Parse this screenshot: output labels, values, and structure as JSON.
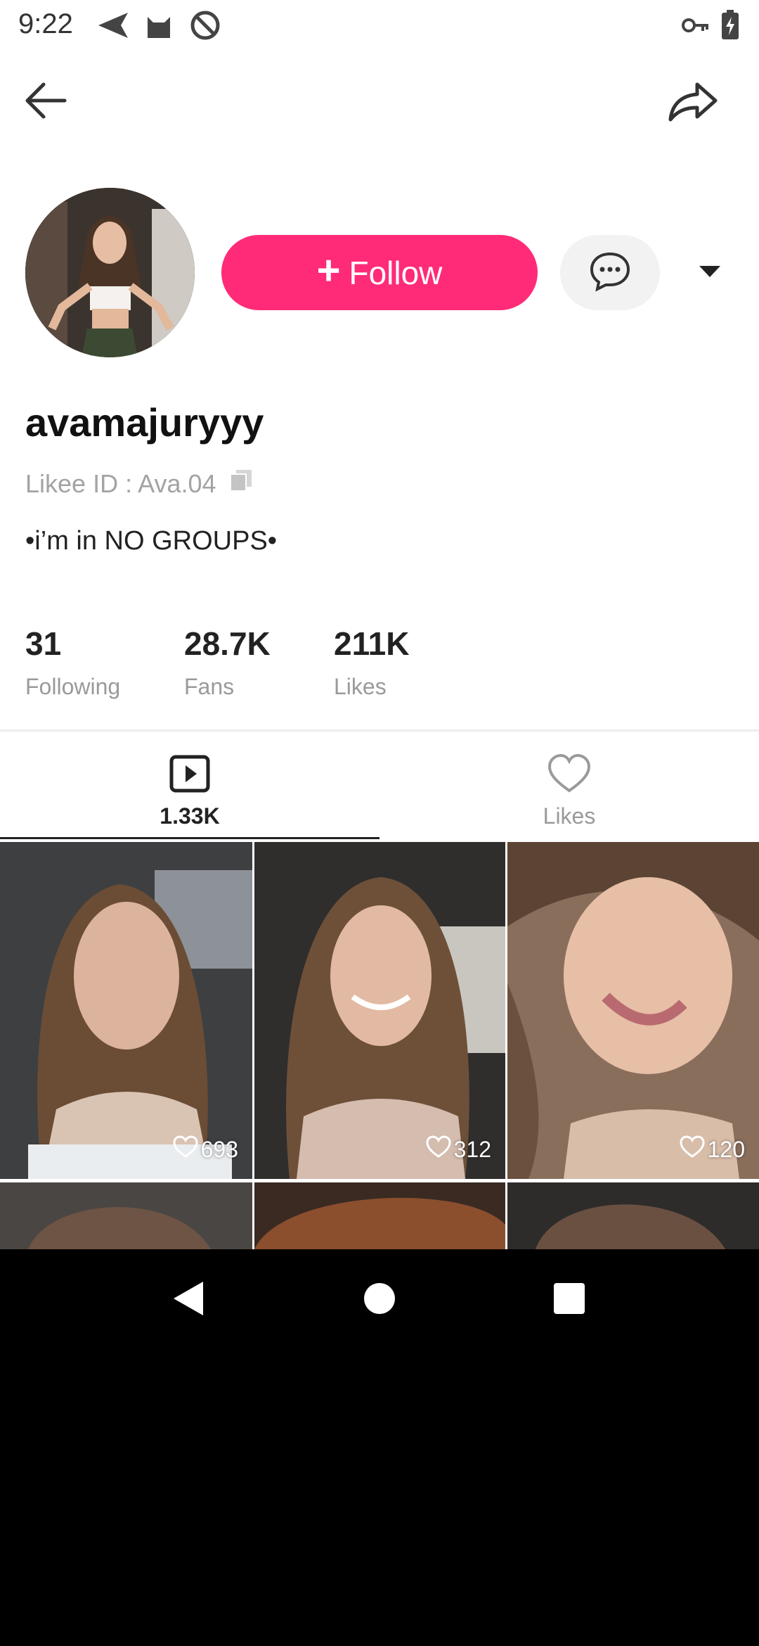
{
  "status_bar": {
    "time": "9:22",
    "icons": [
      "send-icon",
      "cat-icon",
      "at-sign-icon",
      "key-icon",
      "battery-charging-icon"
    ]
  },
  "toolbar": {
    "back_icon": "arrow-left-icon",
    "share_icon": "share-icon"
  },
  "profile": {
    "username": "avamajuryyy",
    "likee_id": "Likee ID : Ava.04",
    "bio": "•i’m in NO GROUPS•",
    "follow_label": "Follow",
    "stats": [
      {
        "value": "31",
        "label": "Following"
      },
      {
        "value": "28.7K",
        "label": "Fans"
      },
      {
        "value": "211K",
        "label": "Likes"
      }
    ]
  },
  "tabs": [
    {
      "label": "1.33K",
      "icon": "video-icon",
      "active": true
    },
    {
      "label": "Likes",
      "icon": "heart-icon",
      "active": false
    }
  ],
  "videos": [
    {
      "likes": "693"
    },
    {
      "likes": "312"
    },
    {
      "likes": "120"
    },
    {
      "likes": ""
    },
    {
      "likes": ""
    },
    {
      "likes": ""
    }
  ],
  "nav": {
    "back": "nav-back-icon",
    "home": "nav-home-icon",
    "recents": "nav-recents-icon"
  },
  "colors": {
    "accent": "#ff2b78",
    "muted": "#9a9a9a"
  }
}
